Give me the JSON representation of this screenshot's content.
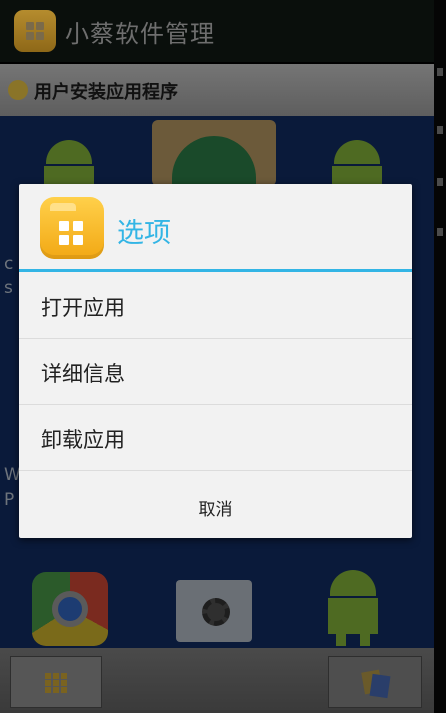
{
  "app": {
    "title": "小蔡软件管理",
    "section_title": "用户安装应用程序"
  },
  "background": {
    "partial_labels": [
      "c",
      "s",
      "W",
      "P"
    ]
  },
  "dialog": {
    "title": "选项",
    "items": [
      {
        "label": "打开应用"
      },
      {
        "label": "详细信息"
      },
      {
        "label": "卸载应用"
      }
    ],
    "cancel_label": "取消"
  },
  "colors": {
    "accent": "#33b5e5",
    "dialog_bg": "#f2f2f2",
    "icon_yellow": "#f2a814"
  },
  "icons": {
    "app_logo": "app-logo-icon",
    "section": "section-icon",
    "dialog": "folder-apps-icon",
    "bottom_left": "grid-icon",
    "bottom_right": "photos-icon"
  }
}
